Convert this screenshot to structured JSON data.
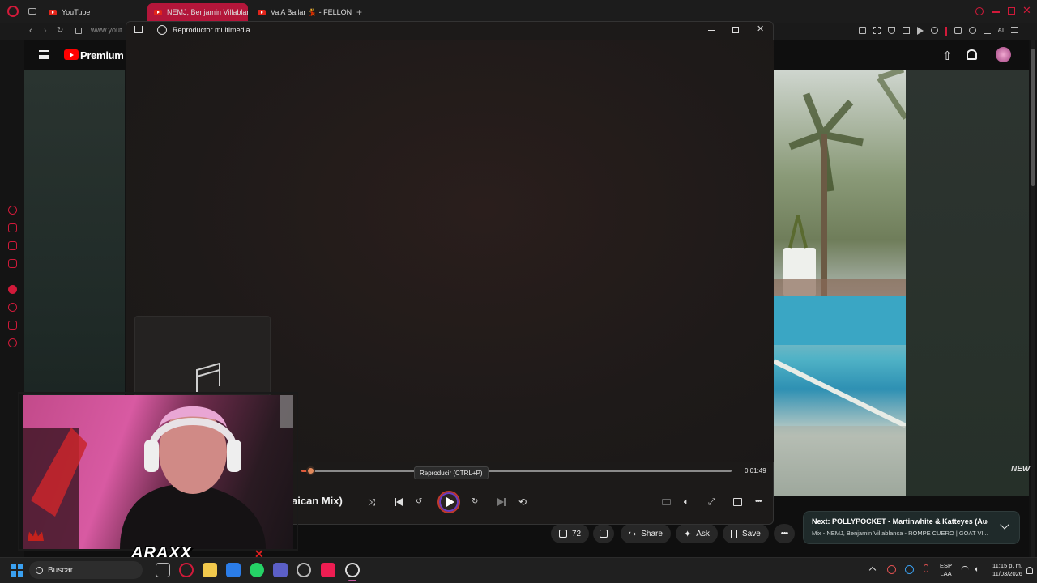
{
  "browser": {
    "tabs": [
      {
        "label": "YouTube"
      },
      {
        "label": "NEMJ, Benjamin Villablanc"
      },
      {
        "label": "Va A Bailar 💃 - FELLON ❌"
      }
    ],
    "url": "www.yout"
  },
  "youtube": {
    "brand": "Premium",
    "like_count": "72",
    "share_label": "Share",
    "ask_label": "Ask",
    "save_label": "Save",
    "next_title": "Next: POLLYPOCKET - Martinwhite & Katteyes (Aud...",
    "next_subtitle": "Mix - NEMJ, Benjamin Villablanca - ROMPE CUERO | GOAT VI...",
    "watermark": "NEW"
  },
  "player": {
    "title": "Reproductor multimedia",
    "song_title": "aican Mix)",
    "time": "0:01:49",
    "tooltip": "Reproducir (CTRL+P)",
    "progress_fraction": 0.02
  },
  "webcam": {
    "logo": "ARAXX"
  },
  "taskbar": {
    "search_placeholder": "Buscar",
    "lang_top": "ESP",
    "lang_bottom": "LAA",
    "clock_time": "11:15 p. m.",
    "clock_date": "11/03/2026"
  },
  "colors": {
    "accent_red": "#e1251b",
    "player_accent": "#e05a3a"
  }
}
